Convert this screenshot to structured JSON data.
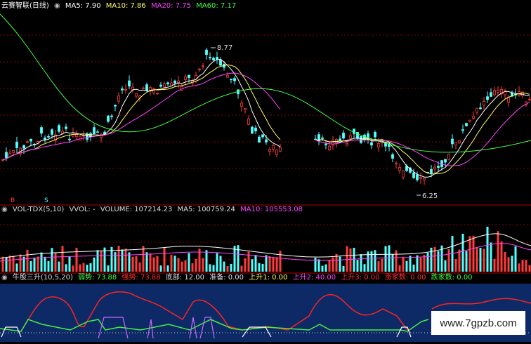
{
  "price_panel": {
    "title": "云赛智联(日线)",
    "ma_labels": [
      {
        "text": "MA5: 7.90",
        "color": "#ffffff"
      },
      {
        "text": "MA10: 7.86",
        "color": "#ffff66"
      },
      {
        "text": "MA20: 7.75",
        "color": "#ff44ff"
      },
      {
        "text": "MA60: 7.17",
        "color": "#44ff44"
      }
    ],
    "high_label": "8.77",
    "low_label": "6.25",
    "markers": [
      "B",
      "S"
    ]
  },
  "volume_panel": {
    "labels": [
      {
        "text": "VOL-TDX(5,10)",
        "color": "#dddddd"
      },
      {
        "text": "VVOL: -",
        "color": "#dddddd"
      },
      {
        "text": "VOLUME: 107214.23",
        "color": "#dddddd"
      },
      {
        "text": "MA5: 100759.24",
        "color": "#dddddd"
      },
      {
        "text": "MA10: 105553.08",
        "color": "#ff44ff"
      }
    ]
  },
  "indicator_panel": {
    "labels": [
      {
        "text": "牛股三升(10,5,20)",
        "color": "#dddddd"
      },
      {
        "text": "弱势: 73.88",
        "color": "#44ff44"
      },
      {
        "text": "强势: 73.88",
        "color": "#ff3333"
      },
      {
        "text": "底部: 12.00",
        "color": "#dddddd"
      },
      {
        "text": "准备: 0.00",
        "color": "#dddddd"
      },
      {
        "text": "上升1: 0.00",
        "color": "#ffff66"
      },
      {
        "text": "上升2: 40.00",
        "color": "#ff44ff"
      },
      {
        "text": "上升3: 0.00",
        "color": "#ff3333"
      },
      {
        "text": "涨家数: 0.00",
        "color": "#ff3333"
      },
      {
        "text": "跌家数: 0.00",
        "color": "#44ff44"
      }
    ]
  },
  "watermark": "www.7gpzb.com",
  "colors": {
    "up": "#ff3b3b",
    "down": "#54ffff",
    "ma5": "#ffffff",
    "ma10": "#ffff66",
    "ma20": "#ff44ff",
    "ma60": "#44ff44",
    "grid": "#8b0000",
    "indicator_bg": "#0d2a66"
  },
  "chart_data": [
    {
      "type": "candlestick",
      "title": "云赛智联(日线)",
      "series": [
        "MA5",
        "MA10",
        "MA20",
        "MA60"
      ],
      "annotations": {
        "high": 8.77,
        "low": 6.25
      },
      "ylim": [
        6.1,
        9.0
      ]
    },
    {
      "type": "bar",
      "title": "VOL-TDX(5,10)",
      "values_shown": {
        "VOLUME": 107214.23,
        "MA5": 100759.24,
        "MA10": 105553.08
      }
    },
    {
      "type": "line",
      "title": "牛股三升(10,5,20)",
      "values_shown": {
        "弱势": 73.88,
        "强势": 73.88,
        "底部": 12.0,
        "准备": 0.0,
        "上升1": 0.0,
        "上升2": 40.0,
        "上升3": 0.0,
        "涨家数": 0.0,
        "跌家数": 0.0
      }
    }
  ]
}
